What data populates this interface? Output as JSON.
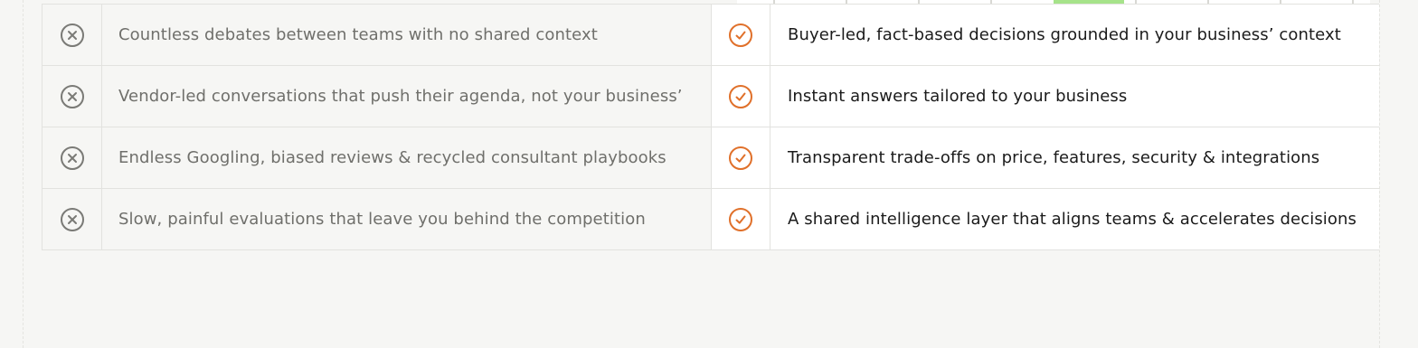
{
  "comparison": {
    "rows": [
      {
        "without": "Countless debates between teams with no shared context",
        "with": "Buyer-led, fact-based decisions grounded in your business’ context"
      },
      {
        "without": "Vendor-led conversations that push their agenda, not your business’",
        "with": "Instant answers tailored to your business"
      },
      {
        "without": "Endless Googling, biased reviews & recycled consultant playbooks",
        "with": "Transparent trade-offs on price, features, security & integrations"
      },
      {
        "without": "Slow, painful evaluations that leave you behind the competition",
        "with": "A shared intelligence layer that aligns teams & accelerates decisions"
      }
    ]
  },
  "icons": {
    "negative": "close-circle-icon",
    "positive": "check-circle-icon"
  },
  "colors": {
    "negative_icon": "#7a7a76",
    "positive_icon": "#e0702a",
    "illustration_accent": "#a6e38a"
  }
}
